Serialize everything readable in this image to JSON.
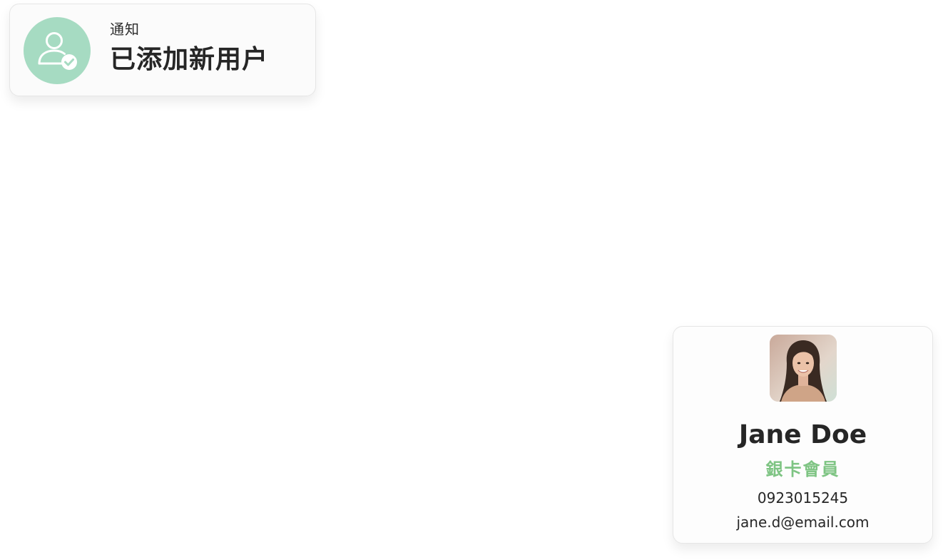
{
  "notification": {
    "kicker": "通知",
    "title": "已添加新用户",
    "icon": "user-added-icon",
    "icon_bg_color": "#a6dbc2"
  },
  "user_card": {
    "avatar": "user-avatar-photo",
    "name": "Jane Doe",
    "tier": "銀卡會員",
    "tier_color": "#7ec483",
    "phone": "0923015245",
    "email": "jane.d@email.com"
  }
}
